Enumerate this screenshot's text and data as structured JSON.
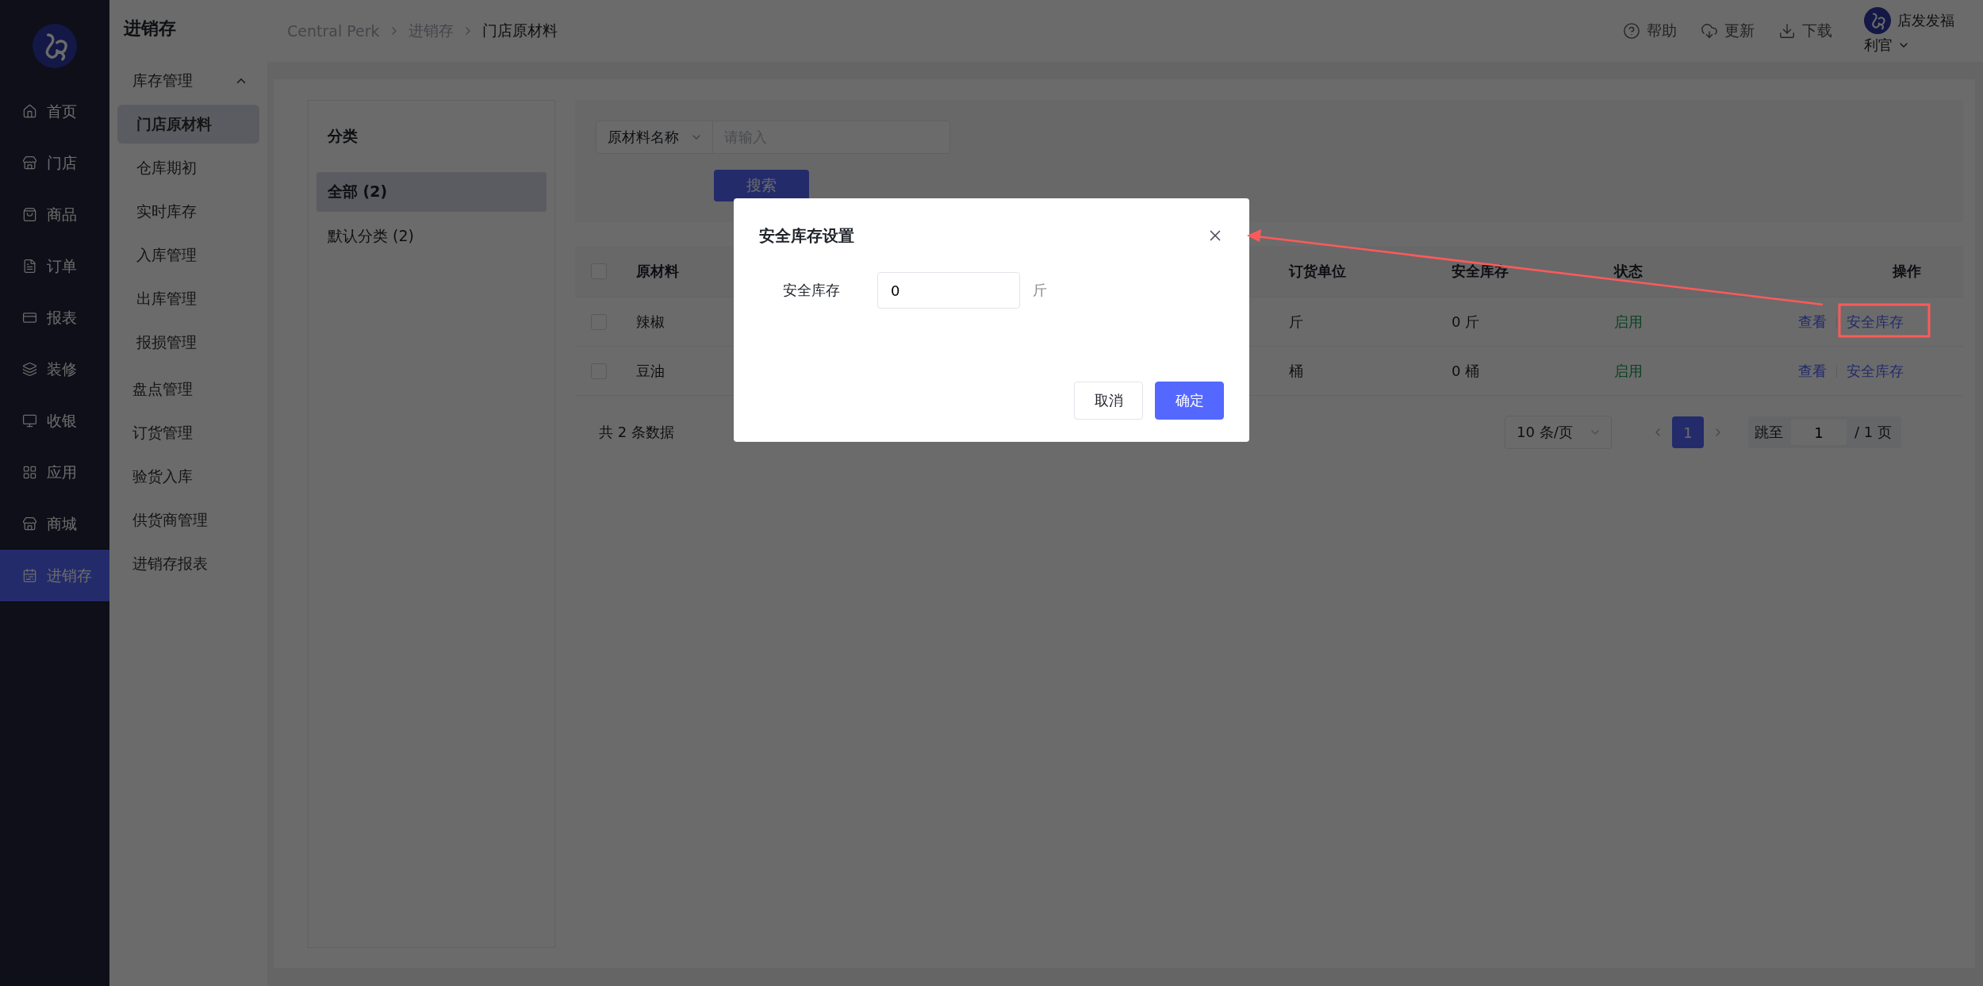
{
  "rail": {
    "items": [
      {
        "label": "首页",
        "selected": false
      },
      {
        "label": "门店",
        "selected": false
      },
      {
        "label": "商品",
        "selected": false
      },
      {
        "label": "订单",
        "selected": false
      },
      {
        "label": "报表",
        "selected": false
      },
      {
        "label": "装修",
        "selected": false
      },
      {
        "label": "收银",
        "selected": false
      },
      {
        "label": "应用",
        "selected": false
      },
      {
        "label": "商城",
        "selected": false
      },
      {
        "label": "进销存",
        "selected": true
      }
    ]
  },
  "submenu": {
    "title": "进销存",
    "group": {
      "label": "库存管理",
      "expanded": true,
      "children": [
        {
          "label": "门店原材料",
          "selected": true
        },
        {
          "label": "仓库期初",
          "selected": false
        },
        {
          "label": "实时库存",
          "selected": false
        },
        {
          "label": "入库管理",
          "selected": false
        },
        {
          "label": "出库管理",
          "selected": false
        },
        {
          "label": "报损管理",
          "selected": false
        }
      ]
    },
    "items": [
      {
        "label": "盘点管理",
        "selected": false
      },
      {
        "label": "订货管理",
        "selected": false
      },
      {
        "label": "验货入库",
        "selected": false
      },
      {
        "label": "供货商管理",
        "selected": false
      },
      {
        "label": "进销存报表",
        "selected": false
      }
    ]
  },
  "header": {
    "breadcrumb": [
      "Central Perk",
      "进销存",
      "门店原材料"
    ],
    "actions": [
      "帮助",
      "更新",
      "下载"
    ],
    "user": {
      "name": "店发发福",
      "role": "利官"
    }
  },
  "categories": {
    "title": "分类",
    "items": [
      {
        "label": "全部 (2)",
        "selected": true
      },
      {
        "label": "默认分类 (2)",
        "selected": false
      }
    ]
  },
  "filter": {
    "field": "原材料名称",
    "placeholder": "请输入",
    "button": "搜索"
  },
  "table": {
    "select_all": false,
    "columns": [
      "原材料",
      "订货单位",
      "安全库存",
      "状态",
      "操作"
    ],
    "rows": [
      {
        "checked": false,
        "name": "辣椒",
        "unit": "斤",
        "safety_stock": "0 斤",
        "status": "启用",
        "actions": [
          "查看",
          "安全库存"
        ]
      },
      {
        "checked": false,
        "name": "豆油",
        "unit": "桶",
        "safety_stock": "0 桶",
        "status": "启用",
        "actions": [
          "查看",
          "安全库存"
        ]
      }
    ]
  },
  "pagination": {
    "total": "共 2 条数据",
    "page_size": "10 条/页",
    "pages": [
      {
        "label": "1",
        "selected": true
      }
    ],
    "jump_label": "跳至",
    "jump_value": "1",
    "page_count": "/ 1 页"
  },
  "dialog": {
    "title": "安全库存设置",
    "field_label": "安全库存",
    "value": "0",
    "unit": "斤",
    "buttons": [
      {
        "label": "取消",
        "kind": "default"
      },
      {
        "label": "确定",
        "kind": "primary"
      }
    ]
  }
}
